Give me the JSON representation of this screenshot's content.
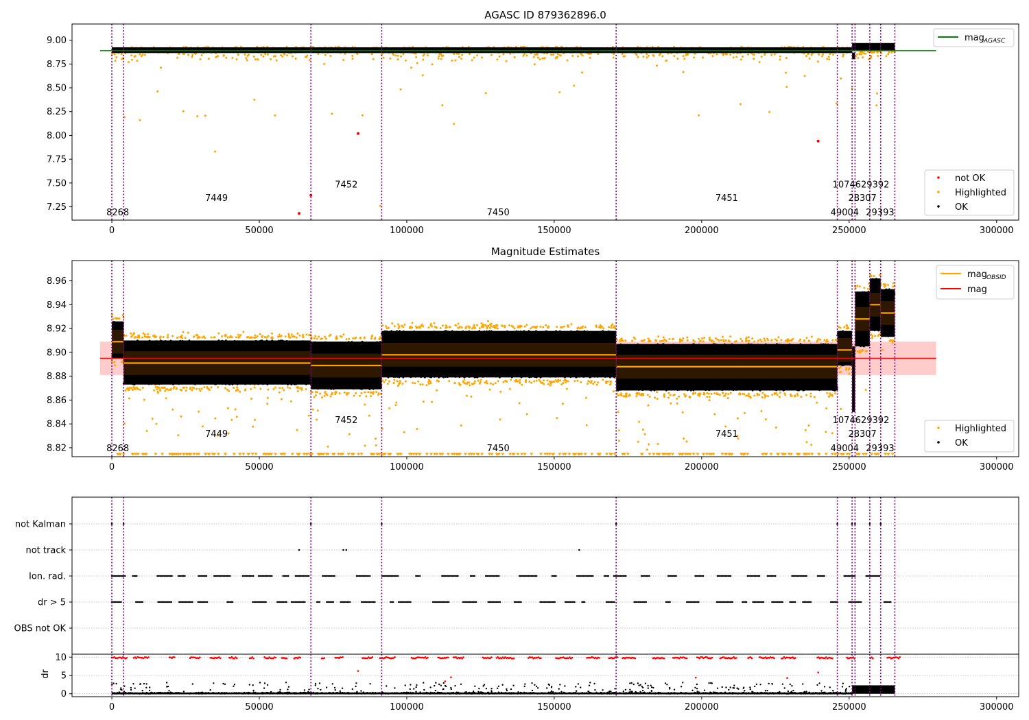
{
  "colors": {
    "ok": "#000000",
    "highlighted": "#ffa500",
    "not_ok": "#ff0000",
    "obsid_line": "#800080",
    "mag_agasc": "#008000",
    "mag": "#ff0000",
    "band": "#ffcccc",
    "grid": "#b0b0b0"
  },
  "obsid_boundaries": [
    0,
    4000,
    67500,
    91500,
    171000,
    246000,
    251000,
    252000,
    257000,
    260700,
    265500
  ],
  "chart_data": [
    {
      "type": "scatter",
      "title": "AGASC ID 879362896.0",
      "xlim": [
        -13500,
        307500
      ],
      "ylim": [
        7.11,
        9.17
      ],
      "xticks": [
        0,
        50000,
        100000,
        150000,
        200000,
        250000,
        300000
      ],
      "xtick_labels": [
        "0",
        "50000",
        "100000",
        "150000",
        "200000",
        "250000",
        "300000"
      ],
      "yticks": [
        7.25,
        7.5,
        7.75,
        8.0,
        8.25,
        8.5,
        8.75,
        9.0
      ],
      "ytick_labels": [
        "7.25",
        "7.50",
        "7.75",
        "8.00",
        "8.25",
        "8.50",
        "8.75",
        "9.00"
      ],
      "mag_agasc": 8.89,
      "legend_top": [
        {
          "label": "mag",
          "sub": "AGASC",
          "color": "#008000"
        }
      ],
      "legend_bottom": [
        "not OK",
        "Highlighted",
        "OK"
      ],
      "not_ok_points": [
        {
          "x": 63500,
          "y": 7.18
        },
        {
          "x": 67500,
          "y": 7.37
        },
        {
          "x": 83500,
          "y": 8.02
        },
        {
          "x": 239500,
          "y": 7.94
        }
      ],
      "obsid_labels": [
        {
          "text": "8268",
          "x": 2000,
          "y": 7.19
        },
        {
          "text": "7449",
          "x": 35500,
          "y": 7.34
        },
        {
          "text": "7452",
          "x": 79500,
          "y": 7.48
        },
        {
          "text": "7450",
          "x": 131000,
          "y": 7.19
        },
        {
          "text": "7451",
          "x": 208500,
          "y": 7.34
        },
        {
          "text": "1074629392",
          "x": 254000,
          "y": 7.48
        },
        {
          "text": "28307",
          "x": 254500,
          "y": 7.34
        },
        {
          "text": "49004",
          "x": 248500,
          "y": 7.19
        },
        {
          "text": "29393",
          "x": 260500,
          "y": 7.19
        }
      ]
    },
    {
      "type": "scatter",
      "title": "Magnitude Estimates",
      "xlim": [
        -13500,
        307500
      ],
      "ylim": [
        8.8125,
        8.977
      ],
      "xticks": [
        0,
        50000,
        100000,
        150000,
        200000,
        250000,
        300000
      ],
      "xtick_labels": [
        "0",
        "50000",
        "100000",
        "150000",
        "200000",
        "250000",
        "300000"
      ],
      "yticks": [
        8.82,
        8.84,
        8.86,
        8.88,
        8.9,
        8.92,
        8.94,
        8.96
      ],
      "ytick_labels": [
        "8.82",
        "8.84",
        "8.86",
        "8.88",
        "8.90",
        "8.92",
        "8.94",
        "8.96"
      ],
      "mag": 8.895,
      "mag_band": [
        8.881,
        8.909
      ],
      "legend_top": [
        {
          "label": "mag",
          "sub": "OBSID",
          "color": "#ffa500"
        },
        {
          "label": "mag",
          "sub": "",
          "color": "#ff0000"
        }
      ],
      "legend_bottom": [
        "Highlighted",
        "OK"
      ],
      "segments": [
        {
          "x0": 0,
          "x1": 4000,
          "mean": 8.909,
          "lo": 8.895,
          "hi": 8.926
        },
        {
          "x0": 4000,
          "x1": 67500,
          "mean": 8.891,
          "lo": 8.873,
          "hi": 8.91
        },
        {
          "x0": 67500,
          "x1": 91500,
          "mean": 8.889,
          "lo": 8.869,
          "hi": 8.909
        },
        {
          "x0": 91500,
          "x1": 171000,
          "mean": 8.898,
          "lo": 8.879,
          "hi": 8.918
        },
        {
          "x0": 171000,
          "x1": 246000,
          "mean": 8.888,
          "lo": 8.868,
          "hi": 8.907
        },
        {
          "x0": 246000,
          "x1": 251000,
          "mean": 8.902,
          "lo": 8.889,
          "hi": 8.918
        },
        {
          "x0": 252000,
          "x1": 257000,
          "mean": 8.928,
          "lo": 8.905,
          "hi": 8.951
        },
        {
          "x0": 257000,
          "x1": 260700,
          "mean": 8.94,
          "lo": 8.918,
          "hi": 8.962
        },
        {
          "x0": 260700,
          "x1": 265500,
          "mean": 8.933,
          "lo": 8.913,
          "hi": 8.953
        }
      ],
      "obsid_labels": [
        {
          "text": "8268",
          "x": 2000,
          "y": 8.8195
        },
        {
          "text": "7449",
          "x": 35500,
          "y": 8.8315
        },
        {
          "text": "7452",
          "x": 79500,
          "y": 8.843
        },
        {
          "text": "7450",
          "x": 131000,
          "y": 8.8195
        },
        {
          "text": "7451",
          "x": 208500,
          "y": 8.8315
        },
        {
          "text": "1074629392",
          "x": 254000,
          "y": 8.843
        },
        {
          "text": "28307",
          "x": 254500,
          "y": 8.8315
        },
        {
          "text": "49004",
          "x": 248500,
          "y": 8.8195
        },
        {
          "text": "29393",
          "x": 260500,
          "y": 8.8195
        }
      ]
    },
    {
      "type": "scatter",
      "title": "",
      "xlim": [
        -13500,
        307500
      ],
      "categories": [
        "not Kalman",
        "not track",
        "Ion. rad.",
        "dr > 5",
        "OBS not OK"
      ],
      "not_track_x": [
        63500,
        78500,
        79500,
        158500
      ]
    },
    {
      "type": "scatter",
      "title": "",
      "ylabel": "dr",
      "xlim": [
        -13500,
        307500
      ],
      "ylim": [
        -0.8,
        10.8
      ],
      "yticks": [
        0,
        5,
        10
      ],
      "ytick_labels": [
        "0",
        "5",
        "10"
      ],
      "xticks": [
        0,
        50000,
        100000,
        150000,
        200000,
        250000,
        300000
      ],
      "xtick_labels": [
        "0",
        "50000",
        "100000",
        "150000",
        "200000",
        "250000",
        "300000"
      ]
    }
  ]
}
